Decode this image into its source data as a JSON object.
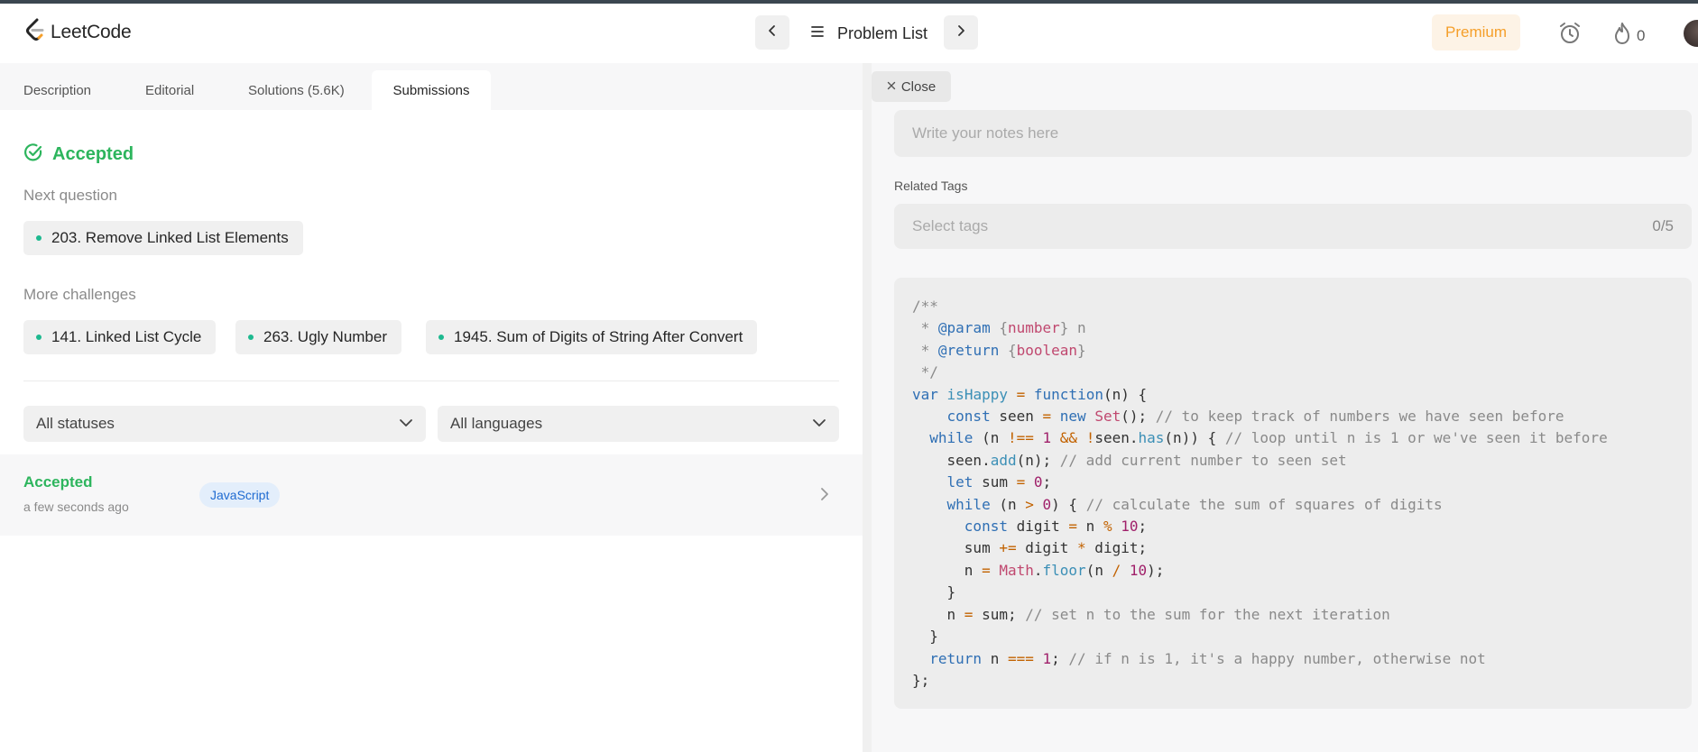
{
  "header": {
    "logo_text": "LeetCode",
    "problem_list_label": "Problem List",
    "premium_label": "Premium",
    "streak_count": "0"
  },
  "tabs": [
    {
      "label": "Description",
      "active": false
    },
    {
      "label": "Editorial",
      "active": false
    },
    {
      "label": "Solutions (5.6K)",
      "active": false
    },
    {
      "label": "Submissions",
      "active": true
    }
  ],
  "result": {
    "status": "Accepted",
    "next_question_label": "Next question",
    "next_question": "203. Remove Linked List Elements",
    "more_challenges_label": "More challenges",
    "challenges": [
      "141. Linked List Cycle",
      "263. Ugly Number",
      "1945. Sum of Digits of String After Convert"
    ]
  },
  "filters": {
    "status": "All statuses",
    "language": "All languages"
  },
  "submissions": [
    {
      "status": "Accepted",
      "time": "a few seconds ago",
      "language": "JavaScript"
    }
  ],
  "notes_panel": {
    "close_label": "Close",
    "notes_placeholder": "Write your notes here",
    "related_tags_label": "Related Tags",
    "tags_placeholder": "Select tags",
    "tags_count": "0/5"
  },
  "code_lines": [
    "/**",
    " * @param {number} n",
    " * @return {boolean}",
    " */",
    "var isHappy = function(n) {",
    "    const seen = new Set(); // to keep track of numbers we have seen before",
    "  while (n !== 1 && !seen.has(n)) { // loop until n is 1 or we've seen it before",
    "    seen.add(n); // add current number to seen set",
    "    let sum = 0;",
    "    while (n > 0) { // calculate the sum of squares of digits",
    "      const digit = n % 10;",
    "      sum += digit * digit;",
    "      n = Math.floor(n / 10);",
    "    }",
    "    n = sum; // set n to the sum for the next iteration",
    "  }",
    "  return n === 1; // if n is 1, it's a happy number, otherwise not",
    "};"
  ],
  "colors": {
    "accepted": "#2db55d",
    "premium": "#f59f2a",
    "badge_text": "#1f6bd1",
    "chip_dot": "#1db98f"
  },
  "icons": [
    "leetcode-logo-icon",
    "chevron-left-icon",
    "list-icon",
    "chevron-right-icon",
    "alarm-clock-icon",
    "flame-icon",
    "check-circle-icon",
    "chevron-down-icon",
    "close-icon"
  ]
}
